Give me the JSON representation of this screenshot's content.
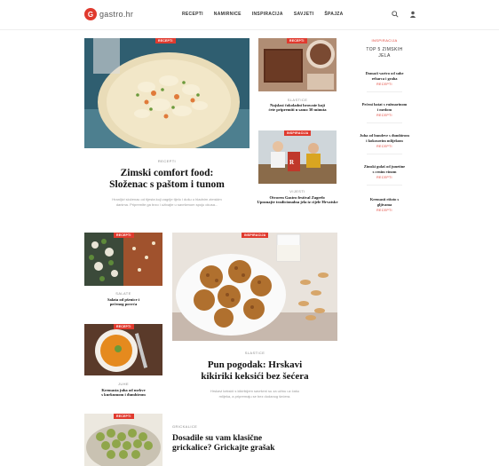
{
  "header": {
    "logo_letter": "G",
    "logo_text": "gastro.hr",
    "nav": [
      "RECEPTI",
      "NAMIRNICE",
      "INSPIRACIJA",
      "SAVJETI",
      "ŠPAJZA"
    ],
    "search_icon": "search-icon",
    "user_icon": "user-icon"
  },
  "featured": {
    "badge": "RECEPTI",
    "category": "RECEPTI",
    "title_line1": "Zimski comfort food:",
    "title_line2": "Složenac s paštom i tunom",
    "excerpt_line1": "Hranljivi složenac od tijesta koji zagrije tijelo i dušu u hladnim zimskim",
    "excerpt_line2": "danima. Pripremite ga brzo i uživajte u savršenom spoju okusa..."
  },
  "right_cards": [
    {
      "badge": "RECEPTI",
      "category": "SLASTICE",
      "title_line1": "Najslasi čokoladni brownie koji",
      "title_line2": "ćete pripremiti u samo 30 minuta"
    },
    {
      "badge": "INSPIRACIJA",
      "category": "VIJESTI",
      "title_line1": "Otvoren Gastro festival Zagreb:",
      "title_line2": "Upoznajte tradicionalna jela iz cijele Hrvatske"
    }
  ],
  "sidebar": {
    "kicker": "INSPIRACIJA",
    "heading_line1": "TOP 5 ZIMSKIH",
    "heading_line2": "JELA",
    "items": [
      {
        "title_line1": "Domaći varivo od suhe",
        "title_line2": "rebarca i graha",
        "category": "RECEPTI"
      },
      {
        "title_line1": "Pečeni batat s ružmarinom",
        "title_line2": "i medom",
        "category": "RECEPTI"
      },
      {
        "title_line1": "Juha od bundeve s đumbirom",
        "title_line2": "i kokosovim mlijekom",
        "category": "RECEPTI"
      },
      {
        "title_line1": "Zimski gulaš od junetine",
        "title_line2": "s crnim vinom",
        "category": "RECEPTI"
      },
      {
        "title_line1": "Kremasti rižoto s",
        "title_line2": "gljivama",
        "category": "RECEPTI"
      }
    ]
  },
  "small_cards": [
    {
      "badge": "RECEPTI",
      "category": "SALATE",
      "title_line1": "Salata od pšenice i",
      "title_line2": "pečenog povrća"
    },
    {
      "badge": "RECEPTI",
      "category": "JUHE",
      "title_line1": "Kremasta juha od mrkve",
      "title_line2": "s kurkumom i đumbirom"
    },
    {
      "badge": "RECEPTI",
      "category": "",
      "title_line1": "",
      "title_line2": ""
    }
  ],
  "cookies": {
    "badge": "INSPIRACIJA",
    "category": "SLASTICE",
    "title_line1": "Pun pogodak: Hrskavi",
    "title_line2": "kikiriki keksići bez šećera",
    "excerpt_line1": "Hrskavi keksići s kikirikijem savršeni su za užinu uz čašu",
    "excerpt_line2": "mlijeka, a pripremaju se bez dodanog šećera."
  },
  "peas": {
    "category": "GRICKALICE",
    "title_line1": "Dosadile su vam klasične",
    "title_line2": "grickalice? Grickajte grašak"
  },
  "colors": {
    "accent": "#e03a2e"
  }
}
